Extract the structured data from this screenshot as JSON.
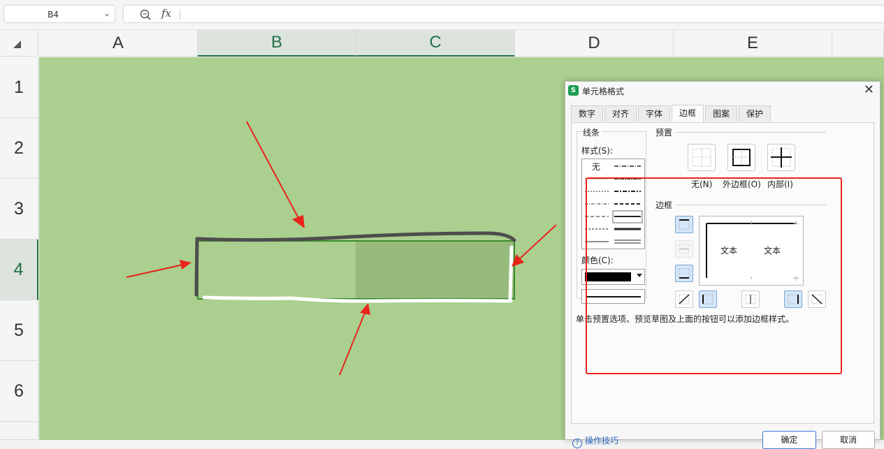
{
  "formula_bar": {
    "name_box": "B4",
    "fx_label": "fx",
    "formula": ""
  },
  "columns": [
    {
      "label": "A",
      "selected": false
    },
    {
      "label": "B",
      "selected": true
    },
    {
      "label": "C",
      "selected": true
    },
    {
      "label": "D",
      "selected": false
    },
    {
      "label": "E",
      "selected": false
    }
  ],
  "rows": [
    {
      "label": "1",
      "selected": false
    },
    {
      "label": "2",
      "selected": false
    },
    {
      "label": "3",
      "selected": false
    },
    {
      "label": "4",
      "selected": true
    },
    {
      "label": "5",
      "selected": false
    },
    {
      "label": "6",
      "selected": false
    }
  ],
  "colors": {
    "sheet_bg": "#aacf8f",
    "selection_border": "#3d8a2b",
    "annotation_arrow": "#e8241b",
    "dialog_highlight": "#e8241b"
  },
  "dialog": {
    "logo": "S",
    "title": "单元格格式",
    "tabs": [
      {
        "label": "数字",
        "active": false
      },
      {
        "label": "对齐",
        "active": false
      },
      {
        "label": "字体",
        "active": false
      },
      {
        "label": "边框",
        "active": true
      },
      {
        "label": "图案",
        "active": false
      },
      {
        "label": "保护",
        "active": false
      }
    ],
    "line_group": "线条",
    "style_label": "样式(S):",
    "style_none": "无",
    "color_label": "颜色(C):",
    "selected_color": "#000000",
    "preset_group": "预置",
    "presets": [
      {
        "label": "无(N)",
        "icon": "border-none-icon"
      },
      {
        "label": "外边框(O)",
        "icon": "border-outline-icon"
      },
      {
        "label": "内部(I)",
        "icon": "border-inside-icon"
      }
    ],
    "border_group": "边框",
    "preview_text_left": "文本",
    "preview_text_right": "文本",
    "hint": "单击预置选项、预览草图及上面的按钮可以添加边框样式。",
    "tips_link": "操作技巧",
    "ok": "确定",
    "cancel": "取消"
  }
}
